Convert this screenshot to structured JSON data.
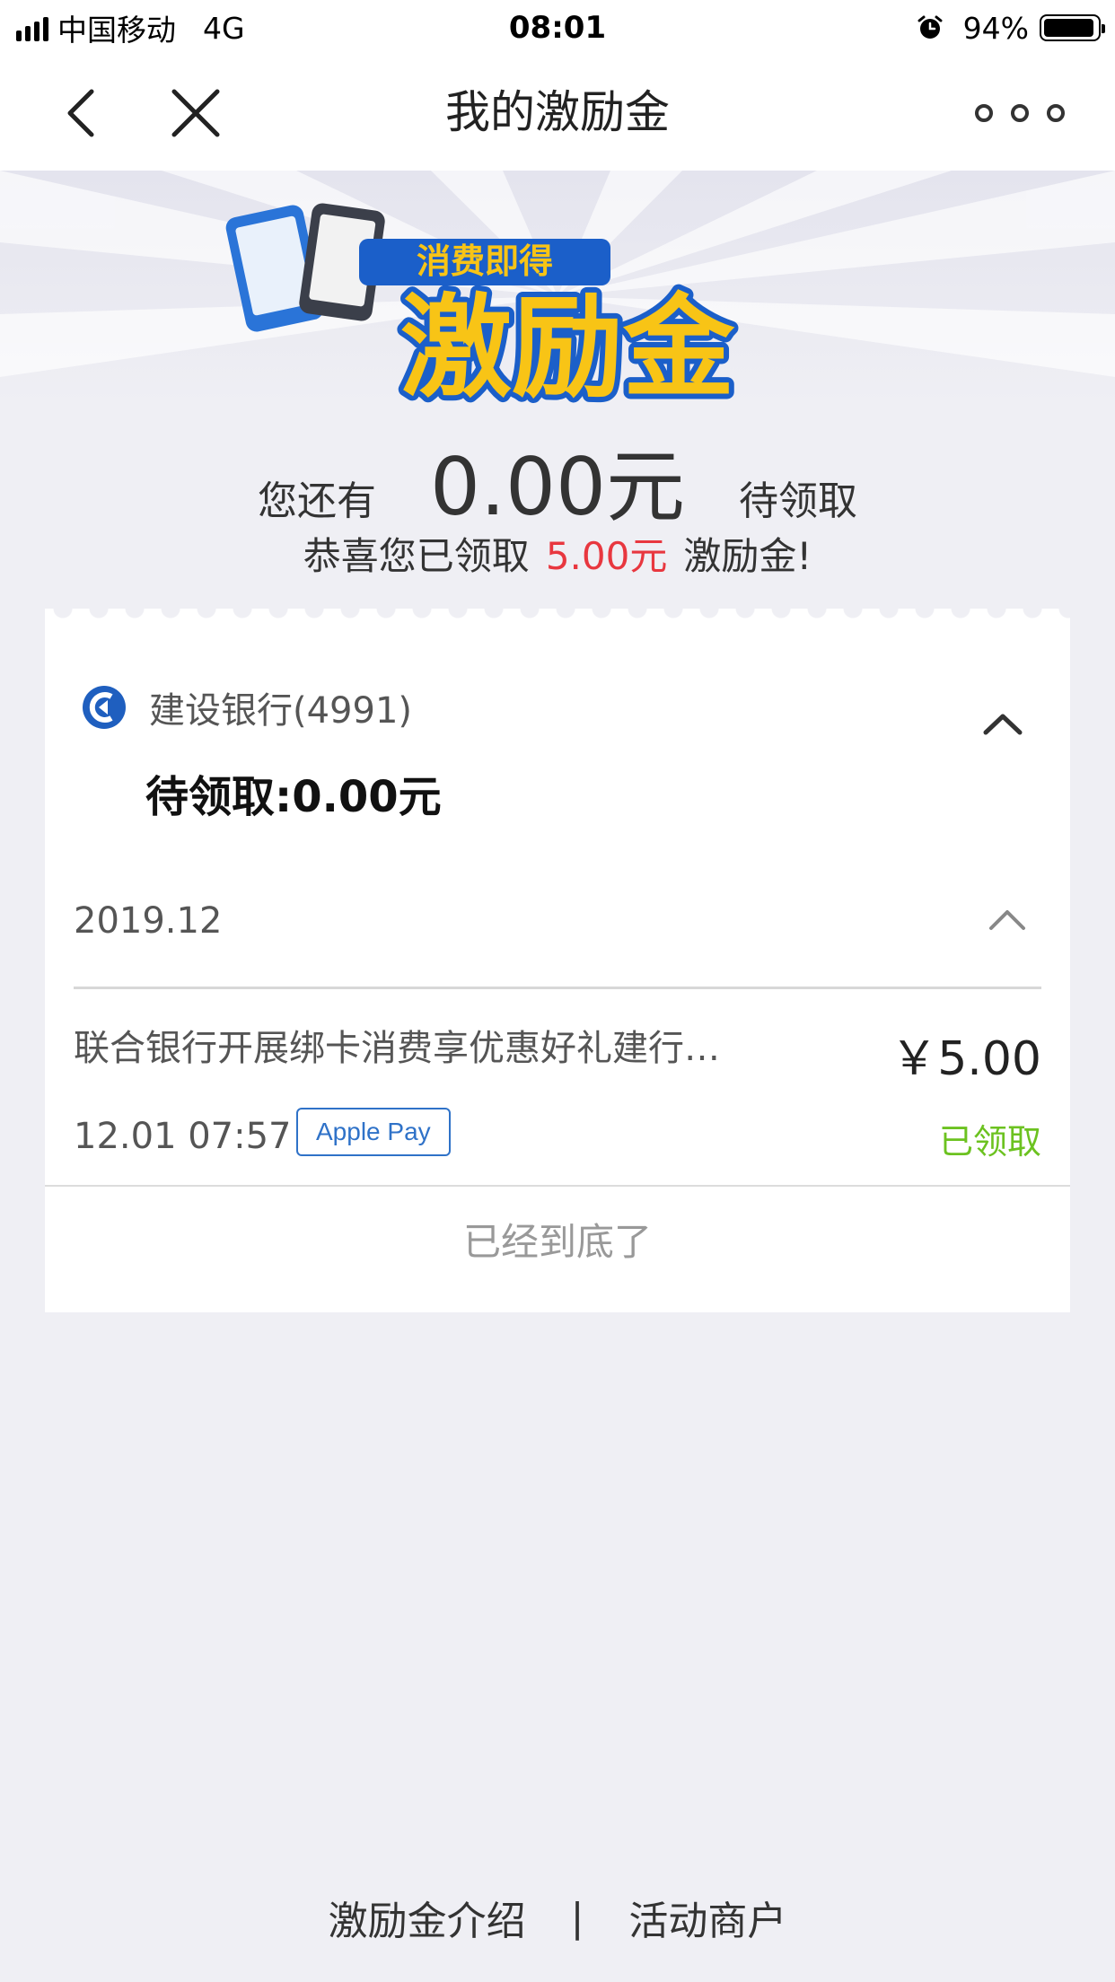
{
  "status_bar": {
    "carrier": "中国移动",
    "network": "4G",
    "time": "08:01",
    "battery": "94%",
    "battery_level": 0.94
  },
  "nav": {
    "title": "我的激励金",
    "back_icon": "chevron-left-icon",
    "close_icon": "close-icon",
    "more_icon": "more-icon"
  },
  "banner": {
    "subtitle": "消费即得",
    "title": "激励金",
    "colors": {
      "text": "#f8c416",
      "outline": "#1b5fc9"
    }
  },
  "summary": {
    "prefix": "您还有",
    "amount": "0.00元",
    "suffix": "待领取"
  },
  "congrats": {
    "before": "恭喜您已领取",
    "amount": "5.00元",
    "after": "激励金!"
  },
  "card": {
    "bank_name": "建设银行(4991)",
    "pending_label": "待领取:0.00元",
    "month": "2019.12",
    "transactions": [
      {
        "title": "联合银行开展绑卡消费享优惠好礼建行…",
        "amount": "￥5.00",
        "time": "12.01 07:57",
        "tag": "Apple Pay",
        "status": "已领取"
      }
    ],
    "end_note": "已经到底了"
  },
  "footer": {
    "intro_link": "激励金介绍",
    "separator": "|",
    "merchants_link": "活动商户"
  },
  "colors": {
    "accent_red": "#e8373f",
    "status_green": "#6cc220",
    "tag_blue": "#2f72c8",
    "background": "#efeff4"
  }
}
